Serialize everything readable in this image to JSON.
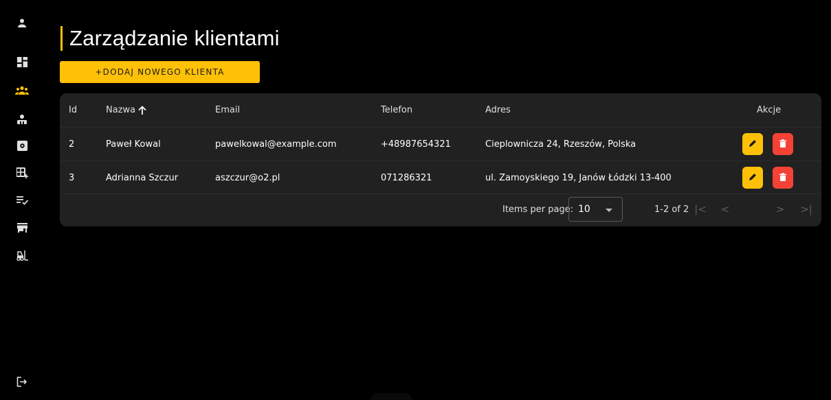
{
  "page": {
    "title": "Zarządzanie klientami",
    "add_button_label": "+DODAJ NOWEGO KLIENTA"
  },
  "sidebar": {
    "items": [
      {
        "icon": "person-icon",
        "active": false
      },
      {
        "icon": "dashboard-icon",
        "active": false
      },
      {
        "icon": "groups-icon",
        "active": true
      },
      {
        "icon": "person-pin-icon",
        "active": false
      },
      {
        "icon": "settings-box-icon",
        "active": false
      },
      {
        "icon": "add-grid-icon",
        "active": false
      },
      {
        "icon": "checklist-icon",
        "active": false
      },
      {
        "icon": "store-icon",
        "active": false
      },
      {
        "icon": "forklift-icon",
        "active": false
      }
    ],
    "logout_icon": "logout-icon"
  },
  "table": {
    "headers": {
      "id": "Id",
      "nazwa": "Nazwa",
      "email": "Email",
      "telefon": "Telefon",
      "adres": "Adres",
      "akcje": "Akcje"
    },
    "sort": {
      "column": "nazwa",
      "direction": "asc"
    },
    "rows": [
      {
        "id": "2",
        "nazwa": "Paweł Kowal",
        "email": "pawelkowal@example.com",
        "telefon": "+48987654321",
        "adres": "Cieplownicza 24, Rzeszów, Polska"
      },
      {
        "id": "3",
        "nazwa": "Adrianna Szczur",
        "email": "aszczur@o2.pl",
        "telefon": "071286321",
        "adres": "ul. Zamoyskiego 19, Janów Łódzki 13-400"
      }
    ]
  },
  "paginator": {
    "items_per_page_label": "Items per page:",
    "page_size": "10",
    "range_label": "1-2 of 2",
    "first": "|<",
    "prev": "<",
    "next": ">",
    "last": ">|"
  },
  "colors": {
    "accent": "#ffc107",
    "danger": "#f44336",
    "card_bg": "#212121",
    "page_bg": "#000000"
  }
}
